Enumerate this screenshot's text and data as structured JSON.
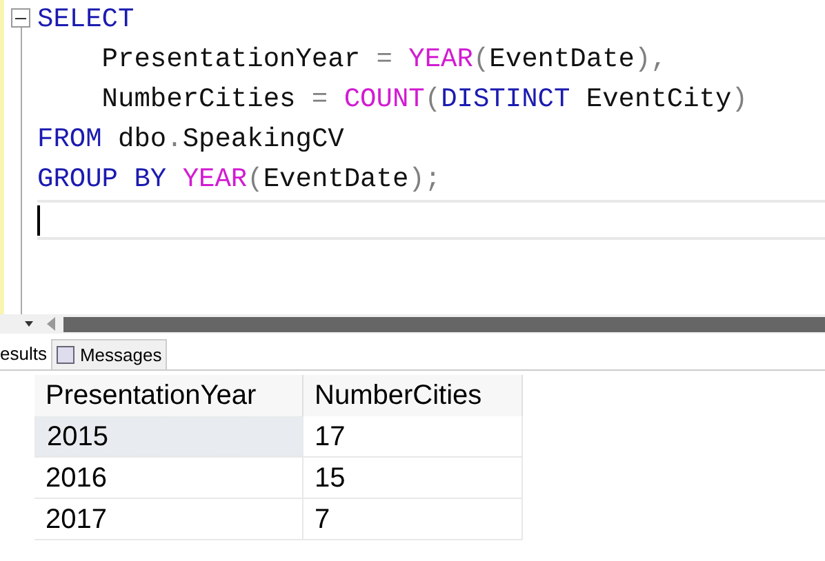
{
  "editor": {
    "lines": [
      {
        "current": false,
        "tokens": [
          {
            "text": "SELECT",
            "kind": "keyword"
          }
        ]
      },
      {
        "current": false,
        "tokens": [
          {
            "text": "    PresentationYear",
            "kind": "plain"
          },
          {
            "text": " = ",
            "kind": "operator"
          },
          {
            "text": "YEAR",
            "kind": "function"
          },
          {
            "text": "(",
            "kind": "operator"
          },
          {
            "text": "EventDate",
            "kind": "plain"
          },
          {
            "text": "),",
            "kind": "operator"
          }
        ]
      },
      {
        "current": false,
        "tokens": [
          {
            "text": "    NumberCities",
            "kind": "plain"
          },
          {
            "text": " = ",
            "kind": "operator"
          },
          {
            "text": "COUNT",
            "kind": "function"
          },
          {
            "text": "(",
            "kind": "operator"
          },
          {
            "text": "DISTINCT",
            "kind": "keyword"
          },
          {
            "text": " EventCity",
            "kind": "plain"
          },
          {
            "text": ")",
            "kind": "operator"
          }
        ]
      },
      {
        "current": false,
        "tokens": [
          {
            "text": "FROM",
            "kind": "keyword"
          },
          {
            "text": " dbo",
            "kind": "plain"
          },
          {
            "text": ".",
            "kind": "operator"
          },
          {
            "text": "SpeakingCV",
            "kind": "plain"
          }
        ]
      },
      {
        "current": false,
        "tokens": [
          {
            "text": "GROUP BY",
            "kind": "keyword"
          },
          {
            "text": " YEAR",
            "kind": "function"
          },
          {
            "text": "(",
            "kind": "operator"
          },
          {
            "text": "EventDate",
            "kind": "plain"
          },
          {
            "text": ");",
            "kind": "operator"
          }
        ]
      },
      {
        "current": true
      }
    ]
  },
  "tabs": [
    {
      "label": "esults",
      "selected": true,
      "kind": "results"
    },
    {
      "label": "Messages",
      "selected": false,
      "kind": "messages"
    }
  ],
  "grid": {
    "columns": [
      "PresentationYear",
      "NumberCities"
    ],
    "rows": [
      {
        "cells": [
          "2015",
          "17"
        ],
        "selected": true
      },
      {
        "cells": [
          "2016",
          "15"
        ],
        "selected": false
      },
      {
        "cells": [
          "2017",
          "7"
        ],
        "selected": false
      }
    ]
  }
}
